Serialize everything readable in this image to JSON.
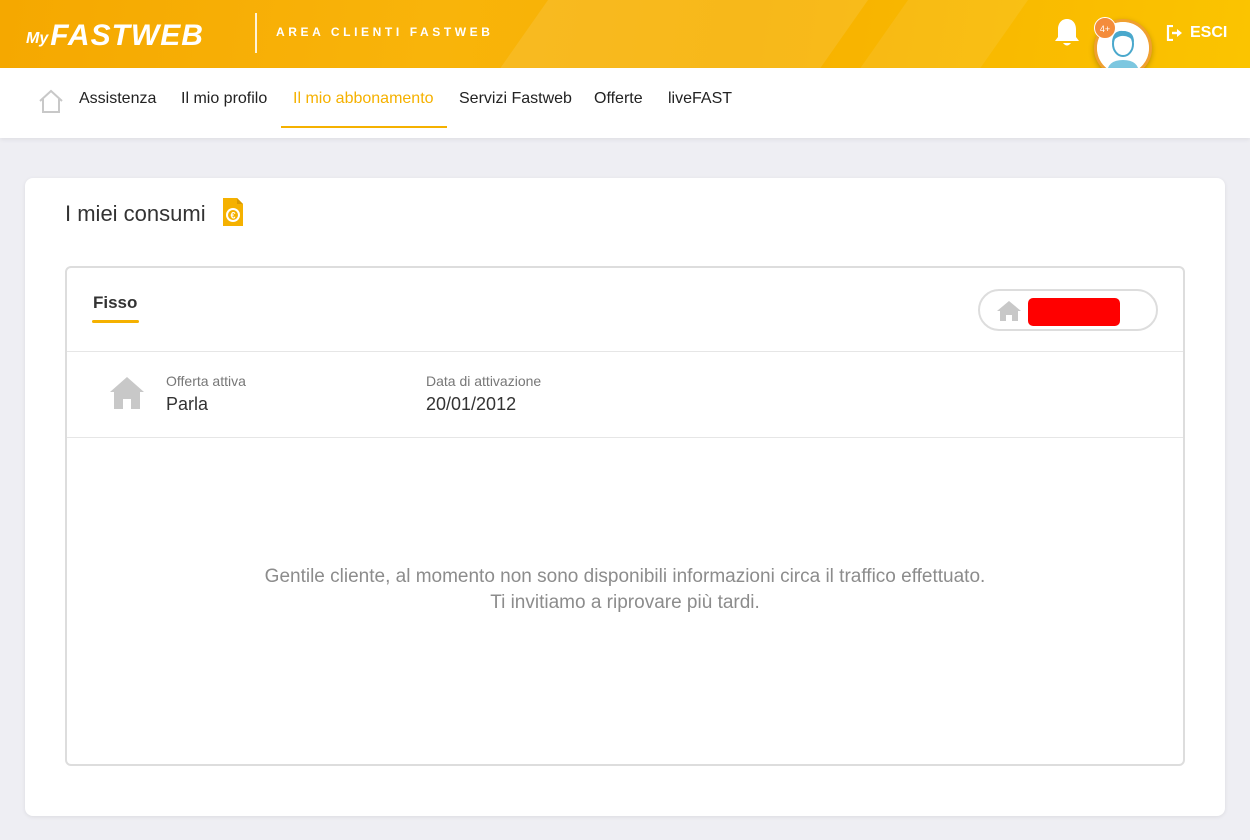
{
  "header": {
    "logo_my": "My",
    "logo_fastweb": "FASTWEB",
    "area_title": "AREA CLIENTI FASTWEB",
    "notification_badge": "4+",
    "logout_label": "ESCI"
  },
  "nav": {
    "items": [
      {
        "label": "Assistenza"
      },
      {
        "label": "Il mio profilo"
      },
      {
        "label": "Il mio abbonamento"
      },
      {
        "label": "Servizi Fastweb"
      },
      {
        "label": "Offerte"
      },
      {
        "label": "liveFAST"
      }
    ],
    "active_index": 2
  },
  "consumi": {
    "title": "I miei consumi",
    "tab_label": "Fisso",
    "offer_label": "Offerta attiva",
    "offer_value": "Parla",
    "activation_label": "Data di attivazione",
    "activation_value": "20/01/2012",
    "message_line1": "Gentile cliente, al momento non sono disponibili informazioni circa il traffico effettuato.",
    "message_line2": "Ti invitiamo a riprovare più tardi."
  },
  "colors": {
    "brand_yellow": "#f5b100",
    "header_gradient_start": "#f5a800",
    "header_gradient_end": "#fbc400",
    "redaction": "#ff0000",
    "page_background": "#eeeef3"
  },
  "icons": {
    "nav_home": "home-outline-icon",
    "bell": "bell-icon",
    "avatar": "user-avatar-icon",
    "logout": "logout-icon",
    "consumi": "euro-document-icon",
    "line_home": "home-icon",
    "offer_home": "home-icon"
  }
}
